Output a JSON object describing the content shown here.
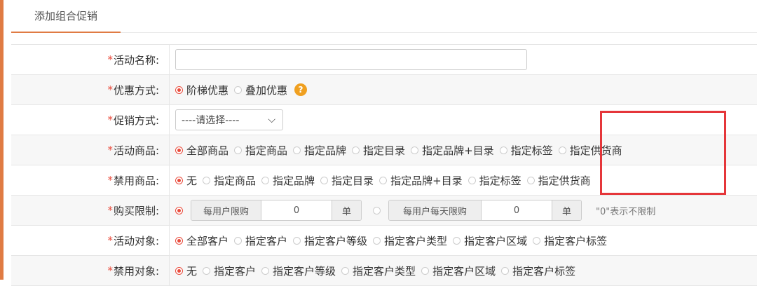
{
  "tab": {
    "label": "添加组合促销"
  },
  "form": {
    "required_mark": "*",
    "activity_name": {
      "label": "活动名称:",
      "value": "",
      "placeholder": ""
    },
    "discount_mode": {
      "label": "优惠方式:",
      "options": [
        {
          "label": "阶梯优惠",
          "selected": true
        },
        {
          "label": "叠加优惠",
          "selected": false
        }
      ],
      "help_icon": "?"
    },
    "promo_mode": {
      "label": "促销方式:",
      "selected": "----请选择----",
      "chevron": "⌵"
    },
    "activity_goods": {
      "label": "活动商品:",
      "options": [
        {
          "label": "全部商品",
          "selected": true
        },
        {
          "label": "指定商品",
          "selected": false
        },
        {
          "label": "指定品牌",
          "selected": false
        },
        {
          "label": "指定目录",
          "selected": false
        },
        {
          "label": "指定品牌+目录",
          "selected": false
        },
        {
          "label": "指定标签",
          "selected": false
        },
        {
          "label": "指定供货商",
          "selected": false
        }
      ]
    },
    "banned_goods": {
      "label": "禁用商品:",
      "options": [
        {
          "label": "无",
          "selected": true
        },
        {
          "label": "指定商品",
          "selected": false
        },
        {
          "label": "指定品牌",
          "selected": false
        },
        {
          "label": "指定目录",
          "selected": false
        },
        {
          "label": "指定品牌+目录",
          "selected": false
        },
        {
          "label": "指定标签",
          "selected": false
        },
        {
          "label": "指定供货商",
          "selected": false
        }
      ]
    },
    "purchase_limit": {
      "label": "购买限制:",
      "per_user": {
        "prefix": "每用户限购",
        "value": "0",
        "unit": "单",
        "selected": true
      },
      "per_user_daily": {
        "prefix": "每用户每天限购",
        "value": "0",
        "unit": "单",
        "selected": false
      },
      "hint": "\"0\"表示不限制"
    },
    "activity_target": {
      "label": "活动对象:",
      "options": [
        {
          "label": "全部客户",
          "selected": true
        },
        {
          "label": "指定客户",
          "selected": false
        },
        {
          "label": "指定客户等级",
          "selected": false
        },
        {
          "label": "指定客户类型",
          "selected": false
        },
        {
          "label": "指定客户区域",
          "selected": false
        },
        {
          "label": "指定客户标签",
          "selected": false
        }
      ]
    },
    "banned_target": {
      "label": "禁用对象:",
      "options": [
        {
          "label": "无",
          "selected": true
        },
        {
          "label": "指定客户",
          "selected": false
        },
        {
          "label": "指定客户等级",
          "selected": false
        },
        {
          "label": "指定客户类型",
          "selected": false
        },
        {
          "label": "指定客户区域",
          "selected": false
        },
        {
          "label": "指定客户标签",
          "selected": false
        }
      ]
    }
  },
  "colors": {
    "accent": "#e07b43",
    "required": "#e94b3c",
    "highlight_box": "#e5363a",
    "help_icon": "#f0a020"
  }
}
